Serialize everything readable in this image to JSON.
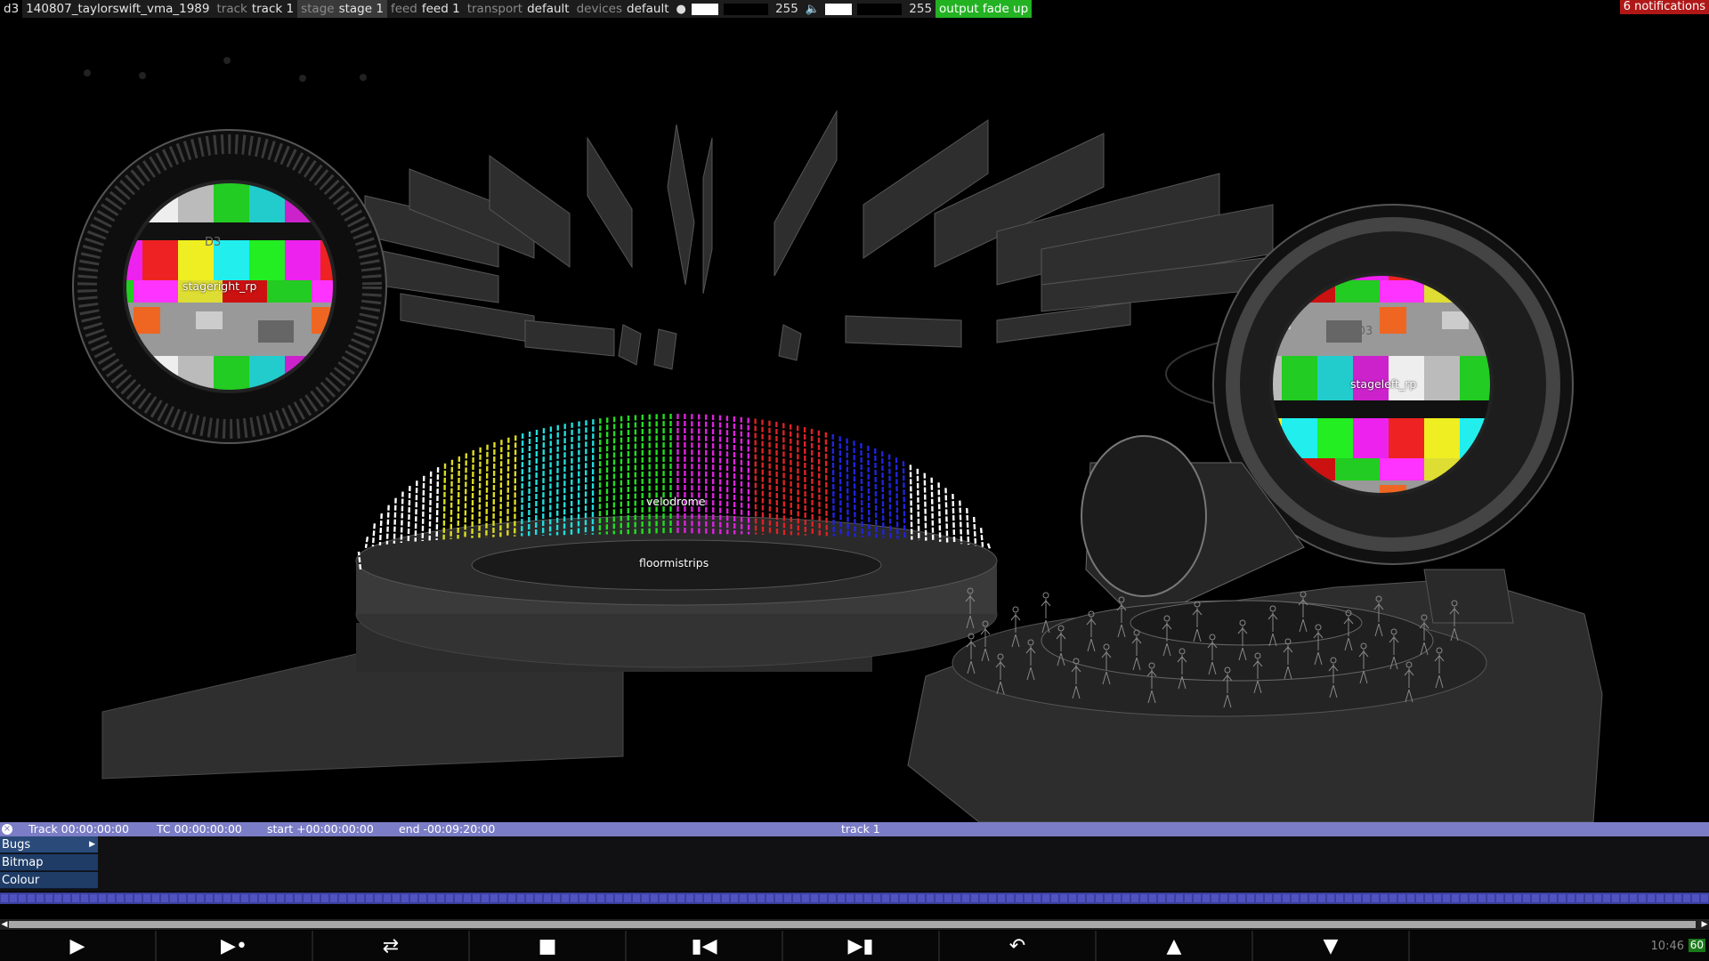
{
  "topbar": {
    "app": "d3",
    "project": "140807_taylorswift_vma_1989",
    "track_key": "track",
    "track_val": "track 1",
    "stage_key": "stage",
    "stage_val": "stage 1",
    "feed_key": "feed",
    "feed_val": "feed 1",
    "transport_key": "transport",
    "transport_val": "default",
    "devices_key": "devices",
    "devices_val": "default",
    "brightness_icon": "bulb-icon",
    "brightness": "255",
    "volume_icon": "speaker-icon",
    "volume": "255",
    "output": "output fade up",
    "notifications": "6 notifications"
  },
  "viewport": {
    "labels": {
      "stageright": "stageright_rp",
      "stageleft": "stageleft_rp",
      "velodrome": "velodrome",
      "floor": "floormistrips"
    },
    "screen_text": "D3"
  },
  "timeline": {
    "track_tc": "Track 00:00:00:00",
    "tc": "TC 00:00:00:00",
    "start": "start +00:00:00:00",
    "end": "end -00:09:20:00",
    "name": "track 1",
    "layers": [
      "Bugs",
      "Bitmap",
      "Colour"
    ]
  },
  "transport": {
    "buttons": [
      "play",
      "play-to-end",
      "loop",
      "stop",
      "previous",
      "next",
      "return",
      "up",
      "down"
    ]
  },
  "status": {
    "clock": "10:46",
    "fps": "60"
  }
}
